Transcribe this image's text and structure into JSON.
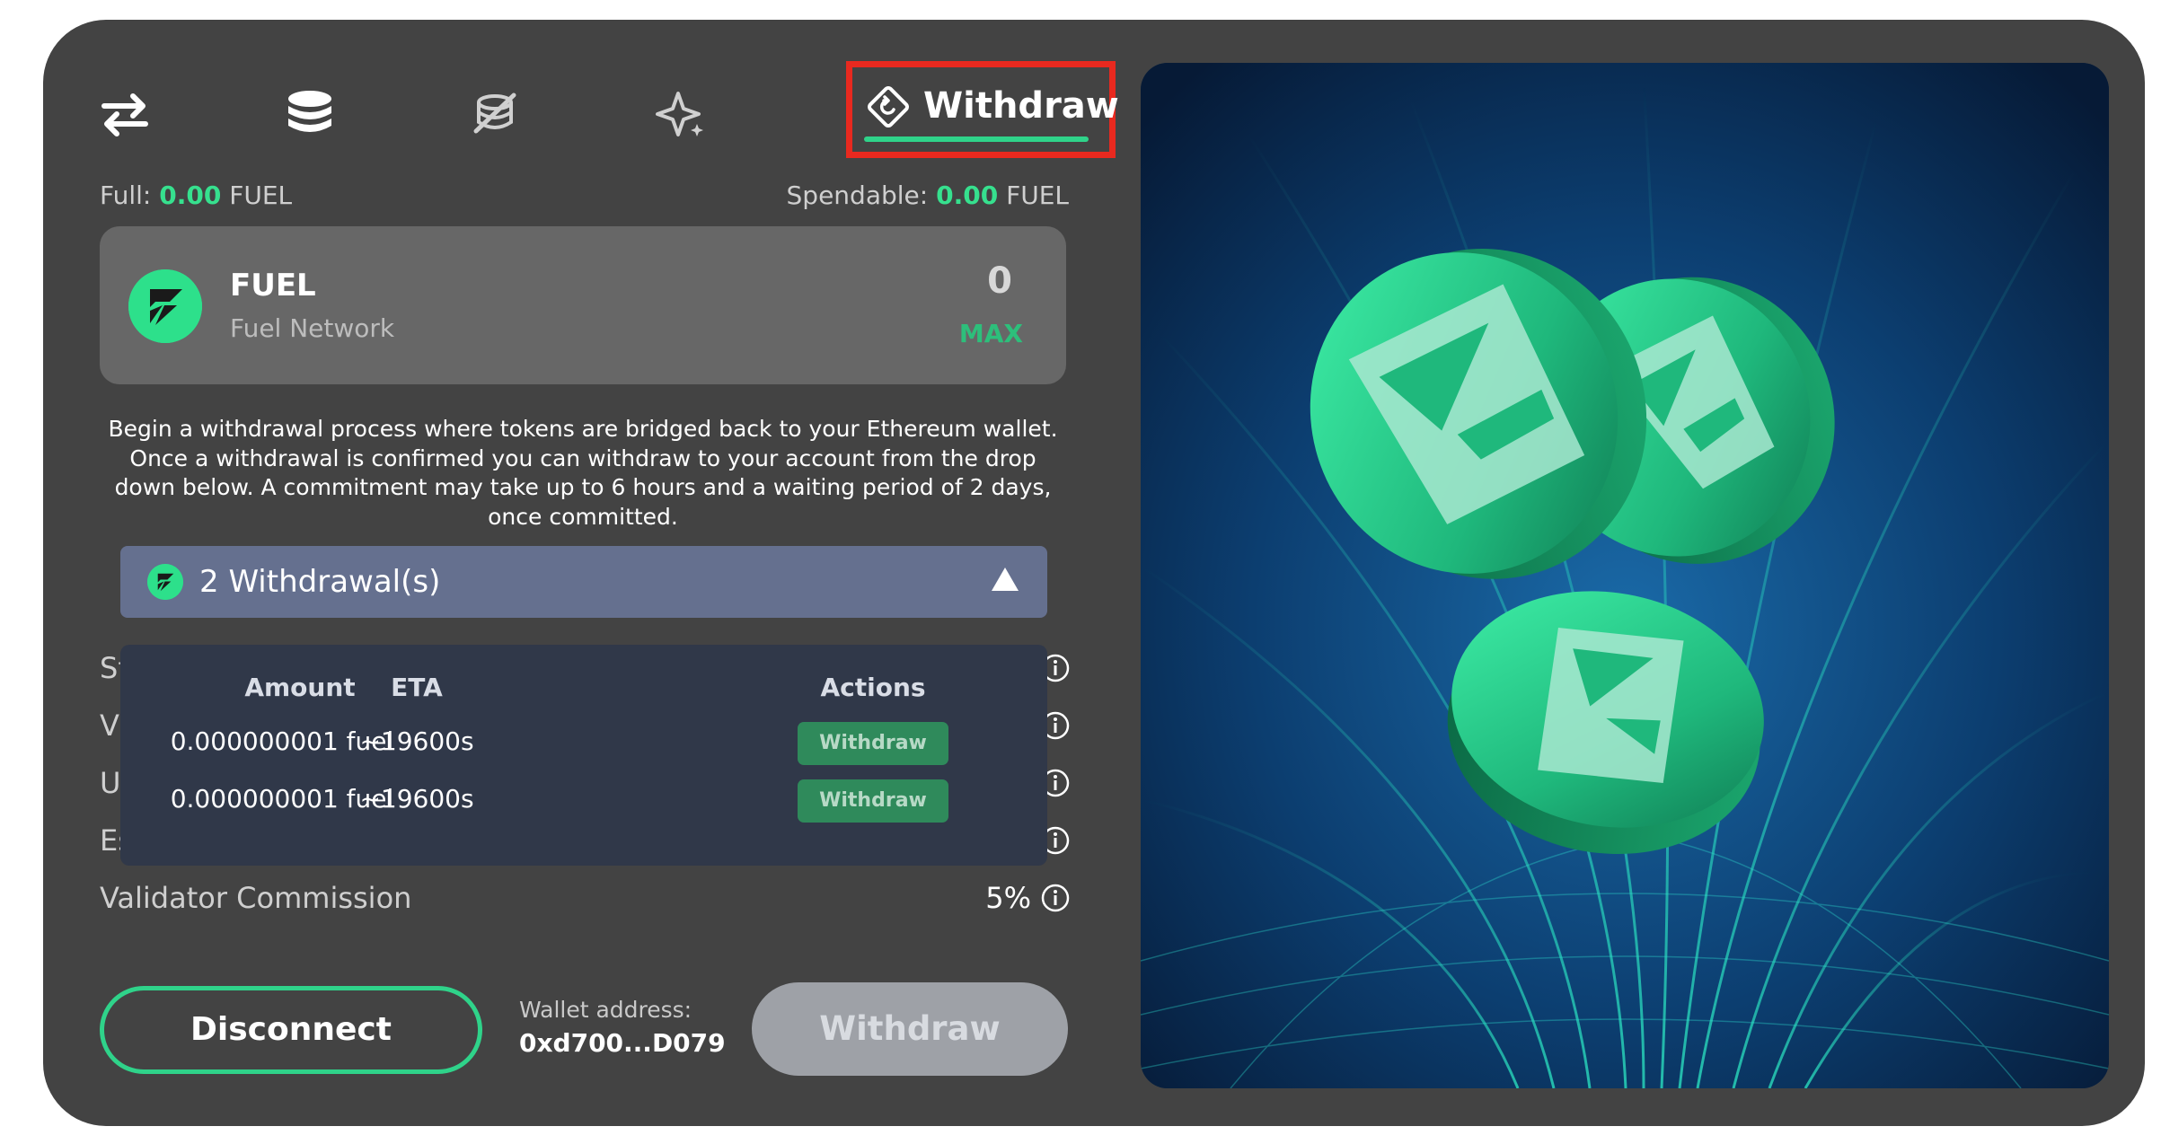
{
  "nav": {
    "active_tab_label": "Withdraw"
  },
  "balance": {
    "full_label": "Full:",
    "full_value": "0.00",
    "full_unit": "FUEL",
    "spendable_label": "Spendable:",
    "spendable_value": "0.00",
    "spendable_unit": "FUEL"
  },
  "token": {
    "name": "FUEL",
    "network": "Fuel Network",
    "amount": "0",
    "max_label": "MAX"
  },
  "description": "Begin a withdrawal process where tokens are bridged back to your Ethereum wallet. Once a withdrawal is confirmed you can withdraw to your account from the drop down below. A commitment may take up to 6 hours and a waiting period of 2 days, once committed.",
  "withdrawals_dropdown": {
    "label": "2 Withdrawal(s)",
    "columns": [
      "Amount",
      "ETA",
      "Actions"
    ],
    "rows": [
      {
        "amount": "0.000000001 fuel",
        "eta": "~19600s",
        "action": "Withdraw"
      },
      {
        "amount": "0.000000001 fuel",
        "eta": "~19600s",
        "action": "Withdraw"
      }
    ]
  },
  "details": {
    "partial_labels": [
      "St",
      "V",
      "U",
      "Es"
    ],
    "commission_label": "Validator Commission",
    "commission_value": "5%"
  },
  "footer": {
    "disconnect_label": "Disconnect",
    "wallet_label": "Wallet address:",
    "wallet_address": "0xd700...D079",
    "withdraw_label": "Withdraw"
  },
  "colors": {
    "card_bg": "#434343",
    "accent_green": "#2fd38a",
    "highlight_red": "#e8291f",
    "dropdown_bg": "#65708f",
    "popover_bg": "#303849"
  }
}
